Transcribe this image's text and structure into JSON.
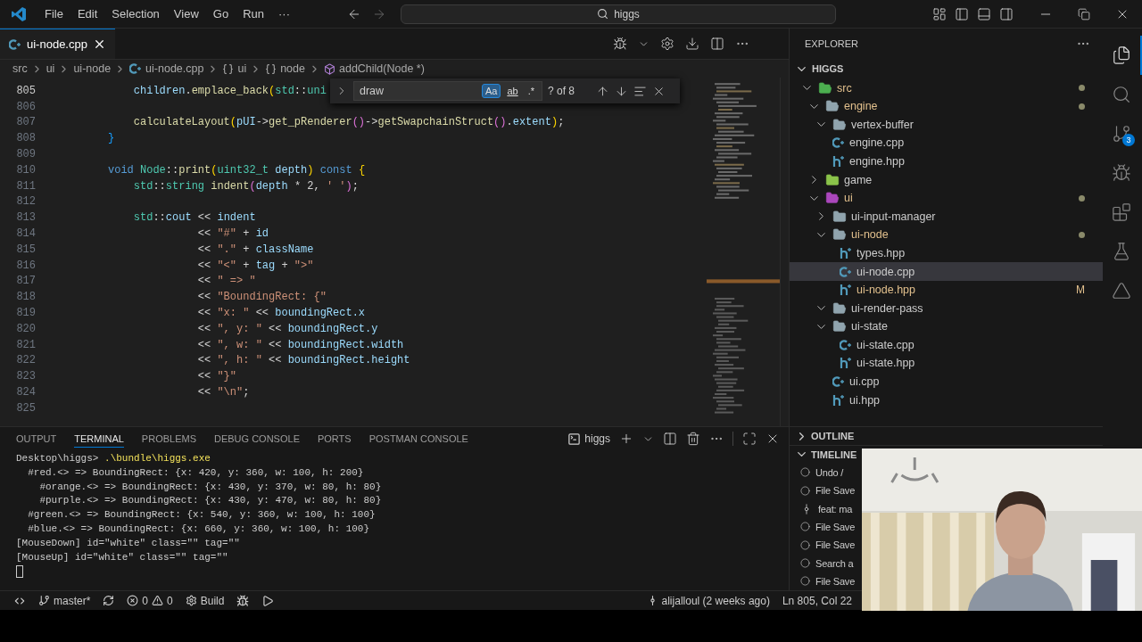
{
  "title_bar": {
    "menus": [
      "File",
      "Edit",
      "Selection",
      "View",
      "Go",
      "Run",
      "···"
    ],
    "command_center": "higgs"
  },
  "editor": {
    "tabs": [
      {
        "label": "ui-node.cpp",
        "kind": "cpp",
        "selected": true
      }
    ],
    "breadcrumbs": [
      {
        "kind": "folder",
        "text": "src"
      },
      {
        "kind": "folder",
        "text": "ui"
      },
      {
        "kind": "folder",
        "text": "ui-node"
      },
      {
        "kind": "cpp",
        "text": "ui-node.cpp"
      },
      {
        "kind": "namespace",
        "text": "ui"
      },
      {
        "kind": "namespace",
        "text": "node"
      },
      {
        "kind": "method",
        "text": "addChild(Node *)"
      }
    ],
    "code": [
      {
        "number": "805",
        "tokens": [
          {
            "kind": "var",
            "text": "    children"
          },
          {
            "kind": "plain",
            "text": "."
          },
          {
            "kind": "func",
            "text": "emplace_back"
          },
          {
            "kind": "bracket1",
            "text": "("
          },
          {
            "kind": "type",
            "text": "std"
          },
          {
            "kind": "plain",
            "text": "::"
          },
          {
            "kind": "type",
            "text": "uni"
          }
        ]
      },
      {
        "number": "806"
      },
      {
        "number": "807",
        "tokens": [
          {
            "kind": "func",
            "text": "    calculateLayout"
          },
          {
            "kind": "bracket1",
            "text": "("
          },
          {
            "kind": "var",
            "text": "pUI"
          },
          {
            "kind": "plain",
            "text": "->"
          },
          {
            "kind": "func",
            "text": "get_pRenderer"
          },
          {
            "kind": "bracket2",
            "text": "()"
          },
          {
            "kind": "plain",
            "text": "->"
          },
          {
            "kind": "func",
            "text": "getSwapchainStruct"
          },
          {
            "kind": "bracket2",
            "text": "()"
          },
          {
            "kind": "plain",
            "text": "."
          },
          {
            "kind": "var",
            "text": "extent"
          },
          {
            "kind": "bracket1",
            "text": ")"
          },
          {
            "kind": "plain",
            "text": ";"
          }
        ]
      },
      {
        "number": "808",
        "tokens": [
          {
            "kind": "bracket3",
            "text": "}"
          }
        ]
      },
      {
        "number": "809"
      },
      {
        "number": "810",
        "tokens": [
          {
            "kind": "keyword",
            "text": "void "
          },
          {
            "kind": "type",
            "text": "Node"
          },
          {
            "kind": "plain",
            "text": "::"
          },
          {
            "kind": "func",
            "text": "print"
          },
          {
            "kind": "bracket1",
            "text": "("
          },
          {
            "kind": "type",
            "text": "uint32_t "
          },
          {
            "kind": "var",
            "text": "depth"
          },
          {
            "kind": "bracket1",
            "text": ")"
          },
          {
            "kind": "keyword",
            "text": " const "
          },
          {
            "kind": "bracket1",
            "text": "{"
          }
        ]
      },
      {
        "number": "811",
        "tokens": [
          {
            "kind": "type",
            "text": "    std"
          },
          {
            "kind": "plain",
            "text": "::"
          },
          {
            "kind": "type",
            "text": "string "
          },
          {
            "kind": "func",
            "text": "indent"
          },
          {
            "kind": "bracket2",
            "text": "("
          },
          {
            "kind": "var",
            "text": "depth"
          },
          {
            "kind": "plain",
            "text": " * 2, "
          },
          {
            "kind": "string",
            "text": "' '"
          },
          {
            "kind": "bracket2",
            "text": ")"
          },
          {
            "kind": "plain",
            "text": ";"
          }
        ]
      },
      {
        "number": "812"
      },
      {
        "number": "813",
        "tokens": [
          {
            "kind": "type",
            "text": "    std"
          },
          {
            "kind": "plain",
            "text": "::"
          },
          {
            "kind": "var",
            "text": "cout"
          },
          {
            "kind": "plain",
            "text": " << "
          },
          {
            "kind": "var",
            "text": "indent"
          }
        ]
      },
      {
        "number": "814",
        "tokens": [
          {
            "kind": "plain",
            "text": "              << "
          },
          {
            "kind": "string",
            "text": "\"#\""
          },
          {
            "kind": "plain",
            "text": " + "
          },
          {
            "kind": "var",
            "text": "id"
          }
        ]
      },
      {
        "number": "815",
        "tokens": [
          {
            "kind": "plain",
            "text": "              << "
          },
          {
            "kind": "string",
            "text": "\".\""
          },
          {
            "kind": "plain",
            "text": " + "
          },
          {
            "kind": "var",
            "text": "className"
          }
        ]
      },
      {
        "number": "816",
        "tokens": [
          {
            "kind": "plain",
            "text": "              << "
          },
          {
            "kind": "string",
            "text": "\"<\""
          },
          {
            "kind": "plain",
            "text": " + "
          },
          {
            "kind": "var",
            "text": "tag"
          },
          {
            "kind": "plain",
            "text": " + "
          },
          {
            "kind": "string",
            "text": "\">\""
          }
        ]
      },
      {
        "number": "817",
        "tokens": [
          {
            "kind": "plain",
            "text": "              << "
          },
          {
            "kind": "string",
            "text": "\" => \""
          }
        ]
      },
      {
        "number": "818",
        "tokens": [
          {
            "kind": "plain",
            "text": "              << "
          },
          {
            "kind": "string",
            "text": "\"BoundingRect: {\""
          }
        ]
      },
      {
        "number": "819",
        "tokens": [
          {
            "kind": "plain",
            "text": "              << "
          },
          {
            "kind": "string",
            "text": "\"x: \""
          },
          {
            "kind": "plain",
            "text": " << "
          },
          {
            "kind": "var",
            "text": "boundingRect.x"
          }
        ]
      },
      {
        "number": "820",
        "tokens": [
          {
            "kind": "plain",
            "text": "              << "
          },
          {
            "kind": "string",
            "text": "\", y: \""
          },
          {
            "kind": "plain",
            "text": " << "
          },
          {
            "kind": "var",
            "text": "boundingRect.y"
          }
        ]
      },
      {
        "number": "821",
        "tokens": [
          {
            "kind": "plain",
            "text": "              << "
          },
          {
            "kind": "string",
            "text": "\", w: \""
          },
          {
            "kind": "plain",
            "text": " << "
          },
          {
            "kind": "var",
            "text": "boundingRect.width"
          }
        ]
      },
      {
        "number": "822",
        "tokens": [
          {
            "kind": "plain",
            "text": "              << "
          },
          {
            "kind": "string",
            "text": "\", h: \""
          },
          {
            "kind": "plain",
            "text": " << "
          },
          {
            "kind": "var",
            "text": "boundingRect.height"
          }
        ]
      },
      {
        "number": "823",
        "tokens": [
          {
            "kind": "plain",
            "text": "              << "
          },
          {
            "kind": "string",
            "text": "\"}\""
          }
        ]
      },
      {
        "number": "824",
        "tokens": [
          {
            "kind": "plain",
            "text": "              << "
          },
          {
            "kind": "string",
            "text": "\"\\n\""
          },
          {
            "kind": "plain",
            "text": ";"
          }
        ]
      },
      {
        "number": "825"
      }
    ],
    "find": {
      "query": "draw",
      "options": [
        {
          "kind": "case",
          "label": "Aa",
          "selected": true
        },
        {
          "kind": "word",
          "label": "ab",
          "selected": false
        },
        {
          "kind": "regex",
          "label": ".*",
          "selected": false
        }
      ],
      "result": "? of 8"
    }
  },
  "panel": {
    "tabs": [
      {
        "label": "OUTPUT",
        "selected": false
      },
      {
        "label": "TERMINAL",
        "selected": true
      },
      {
        "label": "PROBLEMS",
        "selected": false
      },
      {
        "label": "DEBUG CONSOLE",
        "selected": false
      },
      {
        "label": "PORTS",
        "selected": false
      },
      {
        "label": "POSTMAN CONSOLE",
        "selected": false
      }
    ],
    "terminal_name": "higgs",
    "prompt": "Desktop\\higgs> ",
    "command": ".\\bundle\\higgs.exe",
    "lines": [
      "  #red.<> => BoundingRect: {x: 420, y: 360, w: 100, h: 200}",
      "    #orange.<> => BoundingRect: {x: 430, y: 370, w: 80, h: 80}",
      "    #purple.<> => BoundingRect: {x: 430, y: 470, w: 80, h: 80}",
      "  #green.<> => BoundingRect: {x: 540, y: 360, w: 100, h: 100}",
      "  #blue.<> => BoundingRect: {x: 660, y: 360, w: 100, h: 100}",
      "[MouseDown] id=\"white\" class=\"\" tag=\"\"",
      "[MouseUp] id=\"white\" class=\"\" tag=\"\""
    ]
  },
  "explorer": {
    "title": "EXPLORER",
    "root": "HIGGS",
    "tree": [
      {
        "name": "src",
        "kind": "folder",
        "color": "#4caf50",
        "expanded": true,
        "selected": false,
        "modified": true,
        "children": [
          {
            "name": "engine",
            "kind": "folder",
            "color": "#90a4ae",
            "expanded": true,
            "selected": false,
            "modified": true,
            "children": [
              {
                "name": "vertex-buffer",
                "kind": "folder",
                "color": "#90a4ae",
                "expanded": true,
                "selected": false,
                "modified": false
              },
              {
                "name": "engine.cpp",
                "kind": "cpp",
                "selected": false,
                "modified": false
              },
              {
                "name": "engine.hpp",
                "kind": "hpp",
                "selected": false,
                "modified": false
              }
            ]
          },
          {
            "name": "game",
            "kind": "folder",
            "color": "#8bc34a",
            "expanded": false,
            "selected": false,
            "modified": false
          },
          {
            "name": "ui",
            "kind": "folder",
            "color": "#ab47bc",
            "expanded": true,
            "selected": false,
            "modified": true,
            "children": [
              {
                "name": "ui-input-manager",
                "kind": "folder",
                "color": "#90a4ae",
                "expanded": false,
                "selected": false,
                "modified": false
              },
              {
                "name": "ui-node",
                "kind": "folder",
                "color": "#90a4ae",
                "expanded": true,
                "selected": false,
                "modified": true,
                "children": [
                  {
                    "name": "types.hpp",
                    "kind": "hpp",
                    "selected": false,
                    "modified": false
                  },
                  {
                    "name": "ui-node.cpp",
                    "kind": "cpp",
                    "selected": true,
                    "modified": false
                  },
                  {
                    "name": "ui-node.hpp",
                    "kind": "hpp",
                    "selected": false,
                    "modified": true,
                    "badge": "M"
                  }
                ]
              },
              {
                "name": "ui-render-pass",
                "kind": "folder",
                "color": "#90a4ae",
                "expanded": true,
                "selected": false,
                "modified": false
              },
              {
                "name": "ui-state",
                "kind": "folder",
                "color": "#90a4ae",
                "expanded": true,
                "selected": false,
                "modified": false,
                "children": [
                  {
                    "name": "ui-state.cpp",
                    "kind": "cpp",
                    "selected": false,
                    "modified": false
                  },
                  {
                    "name": "ui-state.hpp",
                    "kind": "hpp",
                    "selected": false,
                    "modified": false
                  }
                ]
              },
              {
                "name": "ui.cpp",
                "kind": "cpp",
                "selected": false,
                "modified": false
              },
              {
                "name": "ui.hpp",
                "kind": "hpp",
                "selected": false,
                "modified": false
              }
            ]
          }
        ]
      }
    ],
    "sections": [
      {
        "title": "OUTLINE",
        "expanded": false
      },
      {
        "title": "TIMELINE",
        "expanded": true
      }
    ],
    "timeline": [
      {
        "kind": "save",
        "text": "Undo /"
      },
      {
        "kind": "save",
        "text": "File Save"
      },
      {
        "kind": "commit",
        "text": "feat: ma"
      },
      {
        "kind": "save",
        "text": "File Save"
      },
      {
        "kind": "save",
        "text": "File Save"
      },
      {
        "kind": "save",
        "text": "Search a"
      },
      {
        "kind": "save",
        "text": "File Save"
      }
    ]
  },
  "activity_bar": [
    {
      "kind": "explorer",
      "selected": true
    },
    {
      "kind": "search",
      "selected": false
    },
    {
      "kind": "scm",
      "selected": false,
      "badge": "3"
    },
    {
      "kind": "debug",
      "selected": false
    },
    {
      "kind": "extensions",
      "selected": false
    },
    {
      "kind": "testing",
      "selected": false
    },
    {
      "kind": "tool",
      "selected": false
    }
  ],
  "status_bar": {
    "left": [
      {
        "kind": "remote"
      },
      {
        "kind": "branch",
        "text": "master*"
      },
      {
        "kind": "sync"
      },
      {
        "kind": "problems",
        "errors": "0",
        "warnings": "0"
      },
      {
        "kind": "build",
        "text": "Build"
      },
      {
        "kind": "debug"
      },
      {
        "kind": "run"
      }
    ],
    "right": [
      {
        "kind": "blame",
        "text": "alijalloul (2 weeks ago)"
      },
      {
        "kind": "cursor",
        "text": "Ln 805, Col 22"
      }
    ]
  }
}
